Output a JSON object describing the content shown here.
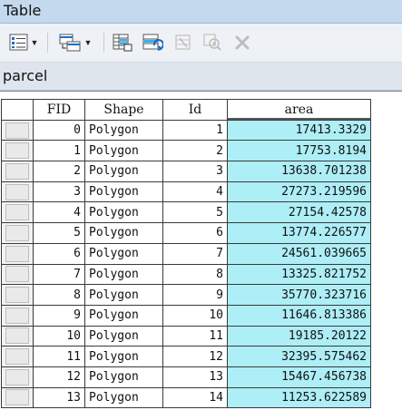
{
  "window": {
    "title": "Table"
  },
  "toolbar": {
    "buttons": [
      {
        "name": "table-options-icon"
      },
      {
        "name": "related-tables-icon"
      },
      {
        "name": "select-by-attributes-icon"
      },
      {
        "name": "switch-selection-icon"
      },
      {
        "name": "clear-selection-icon"
      },
      {
        "name": "zoom-to-selected-icon"
      },
      {
        "name": "delete-selected-icon"
      }
    ]
  },
  "tab": {
    "label": "parcel"
  },
  "table": {
    "columns": [
      "FID",
      "Shape",
      "Id",
      "area"
    ],
    "rows": [
      {
        "fid": "0",
        "shape": "Polygon",
        "id": "1",
        "area": "17413.3329"
      },
      {
        "fid": "1",
        "shape": "Polygon",
        "id": "2",
        "area": "17753.8194"
      },
      {
        "fid": "2",
        "shape": "Polygon",
        "id": "3",
        "area": "13638.701238"
      },
      {
        "fid": "3",
        "shape": "Polygon",
        "id": "4",
        "area": "27273.219596"
      },
      {
        "fid": "4",
        "shape": "Polygon",
        "id": "5",
        "area": "27154.42578"
      },
      {
        "fid": "5",
        "shape": "Polygon",
        "id": "6",
        "area": "13774.226577"
      },
      {
        "fid": "6",
        "shape": "Polygon",
        "id": "7",
        "area": "24561.039665"
      },
      {
        "fid": "7",
        "shape": "Polygon",
        "id": "8",
        "area": "13325.821752"
      },
      {
        "fid": "8",
        "shape": "Polygon",
        "id": "9",
        "area": "35770.323716"
      },
      {
        "fid": "9",
        "shape": "Polygon",
        "id": "10",
        "area": "11646.813386"
      },
      {
        "fid": "10",
        "shape": "Polygon",
        "id": "11",
        "area": "19185.20122"
      },
      {
        "fid": "11",
        "shape": "Polygon",
        "id": "12",
        "area": "32395.575462"
      },
      {
        "fid": "12",
        "shape": "Polygon",
        "id": "13",
        "area": "15467.456738"
      },
      {
        "fid": "13",
        "shape": "Polygon",
        "id": "14",
        "area": "11253.622589"
      }
    ]
  },
  "colors": {
    "selected_column": "#aeeef6",
    "titlebar": "#c4d8ee"
  }
}
